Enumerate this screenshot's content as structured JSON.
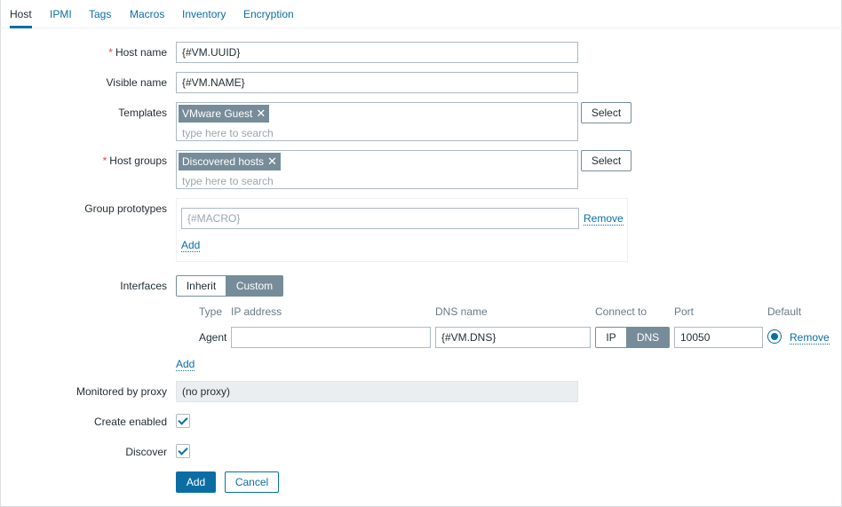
{
  "tabs": [
    "Host",
    "IPMI",
    "Tags",
    "Macros",
    "Inventory",
    "Encryption"
  ],
  "active_tab": "Host",
  "form": {
    "required_mark": "*",
    "host_name": {
      "label": "Host name",
      "value": "{#VM.UUID}"
    },
    "visible_name": {
      "label": "Visible name",
      "value": "{#VM.NAME}"
    },
    "templates": {
      "label": "Templates",
      "chips": [
        "VMware Guest"
      ],
      "placeholder": "type here to search",
      "select_label": "Select"
    },
    "host_groups": {
      "label": "Host groups",
      "chips": [
        "Discovered hosts"
      ],
      "placeholder": "type here to search",
      "select_label": "Select"
    },
    "group_prototypes": {
      "label": "Group prototypes",
      "placeholder": "{#MACRO}",
      "remove_label": "Remove",
      "add_label": "Add"
    },
    "interfaces": {
      "label": "Interfaces",
      "modes": [
        "Inherit",
        "Custom"
      ],
      "selected_mode": "Custom",
      "columns": [
        "Type",
        "IP address",
        "DNS name",
        "Connect to",
        "Port",
        "Default"
      ],
      "rows": [
        {
          "type": "Agent",
          "ip": "",
          "dns": "{#VM.DNS}",
          "connect_options": [
            "IP",
            "DNS"
          ],
          "connect_selected": "DNS",
          "port": "10050",
          "default": true,
          "remove_label": "Remove"
        }
      ],
      "add_label": "Add"
    },
    "proxy": {
      "label": "Monitored by proxy",
      "value": "(no proxy)"
    },
    "create_enabled": {
      "label": "Create enabled",
      "checked": true
    },
    "discover": {
      "label": "Discover",
      "checked": true
    }
  },
  "buttons": {
    "add": "Add",
    "cancel": "Cancel"
  },
  "colors": {
    "accent": "#0a6ea4",
    "chip": "#768d99",
    "required": "#d64e4e"
  },
  "icons": {
    "chip_remove": "close-icon",
    "checkbox": "check-icon",
    "radio": "radio-selected-icon"
  }
}
